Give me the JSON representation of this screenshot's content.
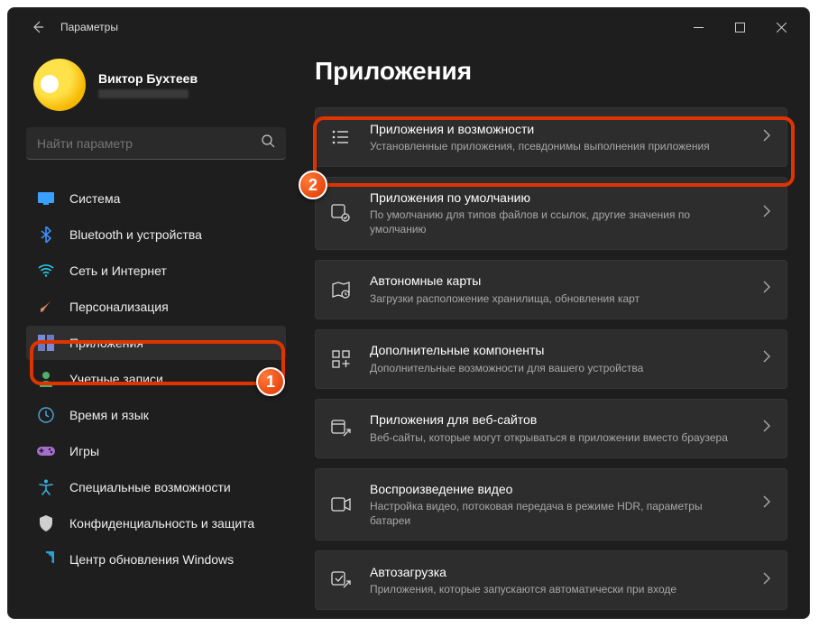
{
  "window": {
    "title": "Параметры"
  },
  "user": {
    "name": "Виктор Бухтеев"
  },
  "search": {
    "placeholder": "Найти параметр"
  },
  "nav": [
    {
      "label": "Система",
      "icon": "system",
      "color": "#3aa0ff"
    },
    {
      "label": "Bluetooth и устройства",
      "icon": "bluetooth",
      "color": "#3a8fff"
    },
    {
      "label": "Сеть и Интернет",
      "icon": "wifi",
      "color": "#29c8e6"
    },
    {
      "label": "Персонализация",
      "icon": "brush",
      "color": "#d98b5d"
    },
    {
      "label": "Приложения",
      "icon": "apps",
      "color": "#7a8ad6",
      "selected": true
    },
    {
      "label": "Учетные записи",
      "icon": "user",
      "color": "#4fb06a"
    },
    {
      "label": "Время и язык",
      "icon": "timelang",
      "color": "#4fa6d6"
    },
    {
      "label": "Игры",
      "icon": "games",
      "color": "#a56fcf"
    },
    {
      "label": "Специальные возможности",
      "icon": "accessibility",
      "color": "#3ab0e0"
    },
    {
      "label": "Конфиденциальность и защита",
      "icon": "shield",
      "color": "#cfcfcf"
    },
    {
      "label": "Центр обновления Windows",
      "icon": "update",
      "color": "#2aa0d0"
    }
  ],
  "main": {
    "title": "Приложения",
    "cards": [
      {
        "title": "Приложения и возможности",
        "subtitle": "Установленные приложения, псевдонимы выполнения приложения",
        "icon": "list",
        "highlight": true
      },
      {
        "title": "Приложения по умолчанию",
        "subtitle": "По умолчанию для типов файлов и ссылок, другие значения по умолчанию",
        "icon": "default"
      },
      {
        "title": "Автономные карты",
        "subtitle": "Загрузки расположение хранилища, обновления карт",
        "icon": "map"
      },
      {
        "title": "Дополнительные компоненты",
        "subtitle": "Дополнительные возможности для вашего устройства",
        "icon": "grid"
      },
      {
        "title": "Приложения для веб-сайтов",
        "subtitle": "Веб-сайты, которые могут открываться в приложении вместо браузера",
        "icon": "weblink"
      },
      {
        "title": "Воспроизведение видео",
        "subtitle": "Настройка видео, потоковая передача в режиме HDR, параметры батареи",
        "icon": "video"
      },
      {
        "title": "Автозагрузка",
        "subtitle": "Приложения, которые запускаются автоматически при входе",
        "icon": "startup"
      }
    ]
  },
  "markers": {
    "m1": "1",
    "m2": "2"
  }
}
